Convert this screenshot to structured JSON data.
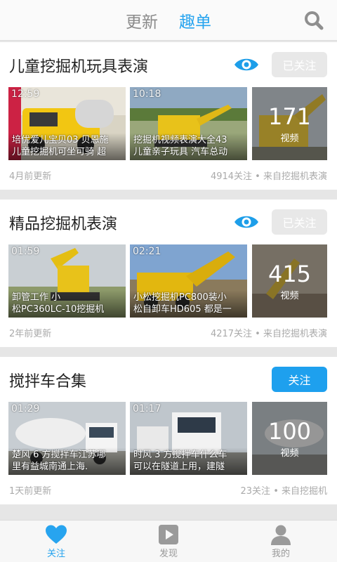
{
  "header": {
    "tabs": [
      {
        "label": "更新",
        "active": false
      },
      {
        "label": "趣单",
        "active": true
      }
    ],
    "search_icon": "search-icon"
  },
  "colors": {
    "accent": "#27a4ef",
    "follow_button": "#1ea0ee",
    "followed_button": "#e8e8e8"
  },
  "cards": [
    {
      "title": "儿童挖掘机玩具表演",
      "follow_label": "已关注",
      "followed": true,
      "videos": [
        {
          "duration": "12:59",
          "caption_line1": "培优爱儿宝贝03 贝恩施",
          "caption_line2": "儿童挖掘机可坐可骑 超"
        },
        {
          "duration": "10:18",
          "caption_line1": "挖掘机视频表演大全43",
          "caption_line2": "儿童亲子玩具 汽车总动"
        }
      ],
      "count": "171",
      "count_label": "视频",
      "updated": "4月前更新",
      "stats": "4914关注 • 来自挖掘机表演"
    },
    {
      "title": "精品挖掘机表演",
      "follow_label": "已关注",
      "followed": true,
      "videos": [
        {
          "duration": "01:59",
          "caption_line1": "卸管工作 小",
          "caption_line2": "松PC360LC-10挖掘机"
        },
        {
          "duration": "02:21",
          "caption_line1": "小松挖掘机PC800装小",
          "caption_line2": "松自卸车HD605 都是一"
        }
      ],
      "count": "415",
      "count_label": "视频",
      "updated": "2年前更新",
      "stats": "4217关注 • 来自挖掘机表演"
    },
    {
      "title": "搅拌车合集",
      "follow_label": "关注",
      "followed": false,
      "videos": [
        {
          "duration": "01:29",
          "caption_line1": "楚风 6 方搅拌车江苏哪",
          "caption_line2": "里有益城南通上海."
        },
        {
          "duration": "01:17",
          "caption_line1": "时风 3 方搅拌车什么车",
          "caption_line2": "可以在隧道上用，建隧"
        }
      ],
      "count": "100",
      "count_label": "视频",
      "updated": "1天前更新",
      "stats": "23关注 • 来自挖掘机"
    }
  ],
  "bottom_nav": [
    {
      "label": "关注",
      "icon": "heart-icon",
      "active": true
    },
    {
      "label": "发现",
      "icon": "play-icon",
      "active": false
    },
    {
      "label": "我的",
      "icon": "person-icon",
      "active": false
    }
  ]
}
